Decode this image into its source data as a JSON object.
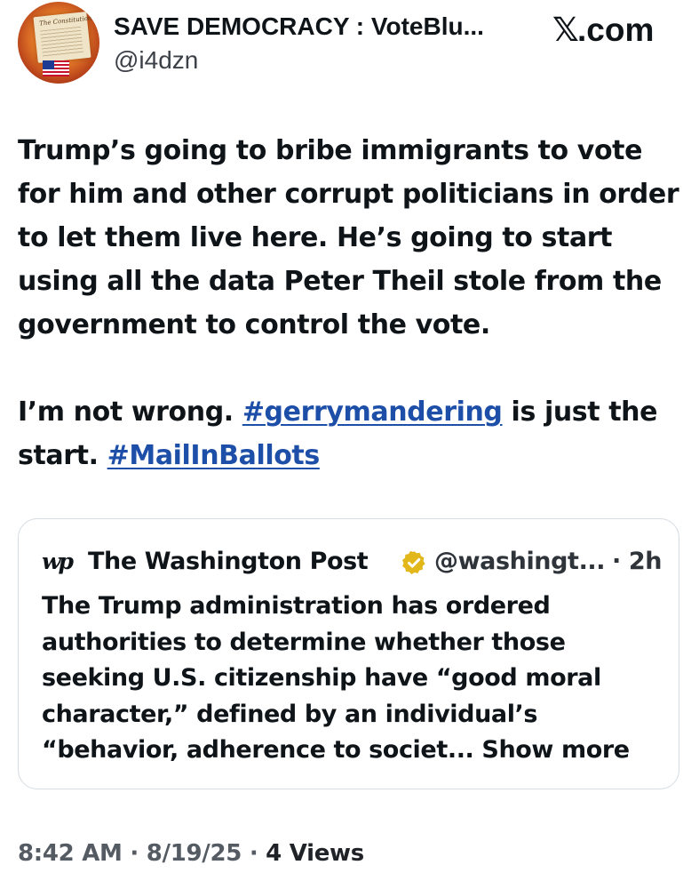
{
  "author": {
    "display_name": "SAVE DEMOCRACY : VoteBlu...",
    "handle": "@i4dzn",
    "avatar_text": "The Constitution"
  },
  "source": {
    "logo_icon": "x-logo-icon",
    "logo_glyph": "𝕏",
    "domain": ".com"
  },
  "tweet": {
    "paragraph1": "Trump’s going to bribe immigrants to vote for him and other corrupt politicians in order to let them live here. He’s going to start using all the data Peter Theil stole from the government to control the vote.",
    "p2_text1": "I’m not wrong. ",
    "hashtag1": "#gerrymandering",
    "p2_text2": " is just the start. ",
    "hashtag2": "#MailInBallots",
    "link_color": "#1d4fa8"
  },
  "quote": {
    "logo_text": "wp",
    "name": "The Washington Post",
    "verified_color": "#e2b719",
    "handle": "@washingt...",
    "time": "· 2h",
    "text": "The Trump administration has ordered authorities to determine whether those seeking U.S. citizenship have “good moral character,” defined by an individual’s “behavior, adherence to societ...",
    "show_more": "Show more"
  },
  "meta": {
    "time": "8:42 AM",
    "sep1": " · ",
    "date": "8/19/25",
    "sep2": " · ",
    "views_count": "4",
    "views_label": " Views"
  }
}
